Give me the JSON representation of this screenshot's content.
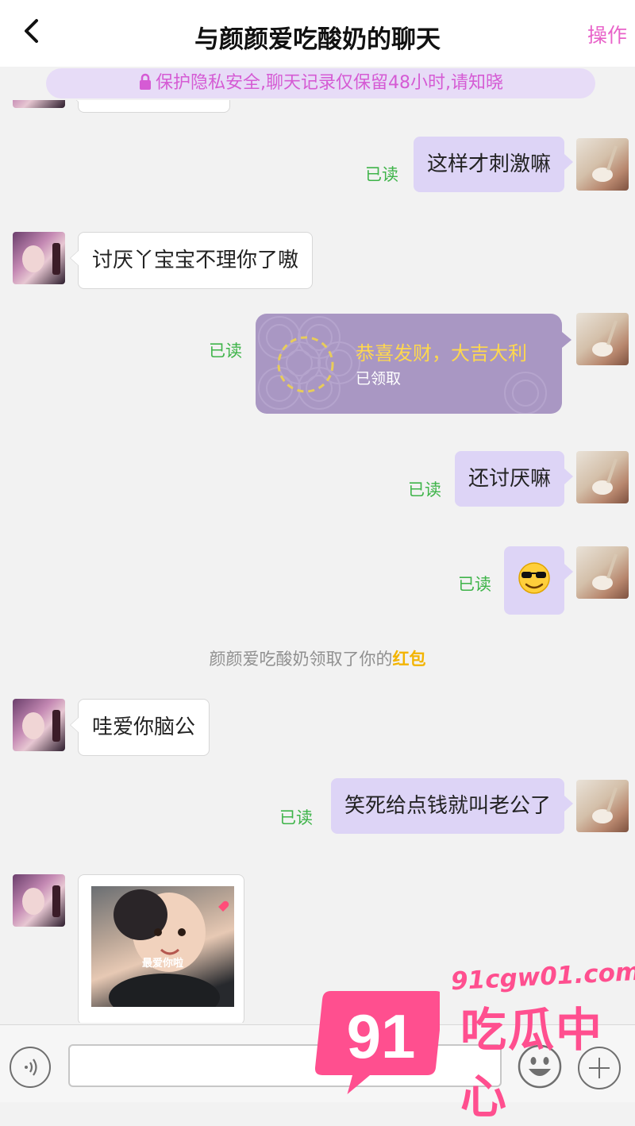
{
  "header": {
    "back_icon": "chevron-left-icon",
    "title": "与颜颜爱吃酸奶的聊天",
    "ops_label": "操作"
  },
  "notice": {
    "icon": "lock-icon",
    "text": "保护隐私安全,聊天记录仅保留48小时,请知晓"
  },
  "read_label": "已读",
  "messages": [
    {
      "from": "me",
      "text": "这样才刺激嘛",
      "status": "已读"
    },
    {
      "from": "her",
      "text": "讨厌丫宝宝不理你了嗷"
    },
    {
      "from": "me",
      "type": "red-packet",
      "title": "恭喜发财，大吉大利",
      "subtitle": "已领取",
      "status": "已读"
    },
    {
      "from": "me",
      "text": "还讨厌嘛",
      "status": "已读"
    },
    {
      "from": "me",
      "text": "😎",
      "status": "已读"
    },
    {
      "from": "her",
      "text": "哇爱你脑公"
    },
    {
      "from": "me",
      "text": "笑死给点钱就叫老公了",
      "status": "已读"
    },
    {
      "from": "her",
      "type": "image",
      "caption": "最爱你啦"
    }
  ],
  "system_notice": {
    "prefix": "颜颜爱吃酸奶领取了你的",
    "highlight": "红包"
  },
  "footer": {
    "voice_icon": "voice-icon",
    "emoji_icon": "smiley-icon",
    "plus_icon": "plus-icon"
  },
  "watermark": {
    "badge": "91",
    "url": "91cgw01.com",
    "name": "吃瓜中心"
  },
  "colors": {
    "accent": "#e862c9",
    "outgoing_bubble": "#ddd4f6",
    "read_status": "#3fb44a",
    "red_packet": "#a997c3",
    "highlight": "#f3b400"
  }
}
